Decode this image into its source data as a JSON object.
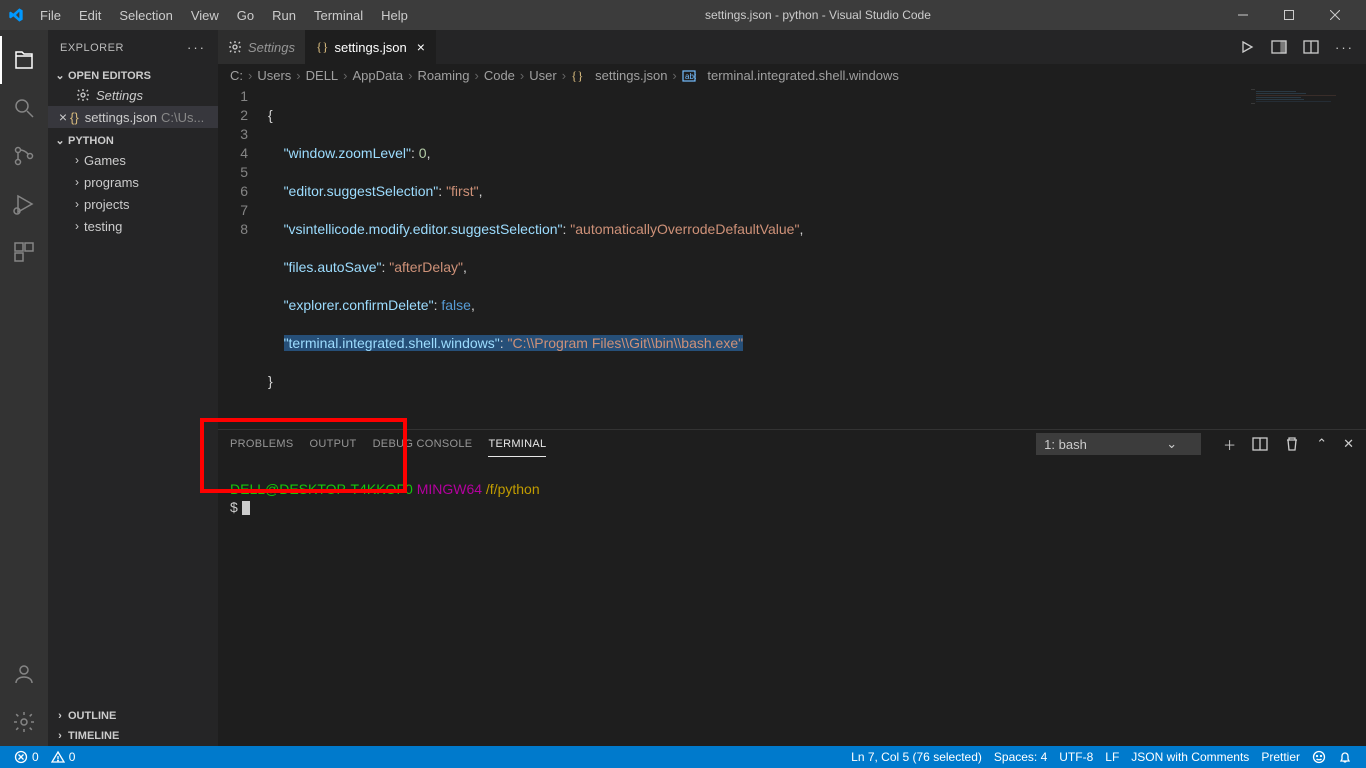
{
  "titlebar": {
    "menus": [
      "File",
      "Edit",
      "Selection",
      "View",
      "Go",
      "Run",
      "Terminal",
      "Help"
    ],
    "title": "settings.json - python - Visual Studio Code"
  },
  "sidebar": {
    "title": "EXPLORER",
    "open_editors_label": "OPEN EDITORS",
    "open_editors": [
      {
        "label": "Settings",
        "modified": false,
        "icon": "settings"
      },
      {
        "label": "settings.json",
        "suffix": "C:\\Us...",
        "modified": false,
        "icon": "braces",
        "close": true,
        "active": true
      }
    ],
    "workspace_label": "PYTHON",
    "folders": [
      "Games",
      "programs",
      "projects",
      "testing"
    ],
    "outline_label": "OUTLINE",
    "timeline_label": "TIMELINE"
  },
  "tabs": [
    {
      "label": "Settings",
      "icon": "settings",
      "active": false,
      "italic": true
    },
    {
      "label": "settings.json",
      "icon": "braces",
      "active": true,
      "close": true
    }
  ],
  "breadcrumbs": [
    "C:",
    "Users",
    "DELL",
    "AppData",
    "Roaming",
    "Code",
    "User"
  ],
  "breadcrumb_file": "settings.json",
  "breadcrumb_symbol": "terminal.integrated.shell.windows",
  "code": {
    "lines": [
      "1",
      "2",
      "3",
      "4",
      "5",
      "6",
      "7",
      "8"
    ],
    "l1": "{",
    "l2k": "\"window.zoomLevel\"",
    "l2v": "0",
    "l3k": "\"editor.suggestSelection\"",
    "l3v": "\"first\"",
    "l4k": "\"vsintellicode.modify.editor.suggestSelection\"",
    "l4v": "\"automaticallyOverrodeDefaultValue\"",
    "l5k": "\"files.autoSave\"",
    "l5v": "\"afterDelay\"",
    "l6k": "\"explorer.confirmDelete\"",
    "l6v": "false",
    "l7k": "\"terminal.integrated.shell.windows\"",
    "l7v": "\"C:\\\\Program Files\\\\Git\\\\bin\\\\bash.exe\"",
    "l8": "}"
  },
  "panel": {
    "tabs": [
      "PROBLEMS",
      "OUTPUT",
      "DEBUG CONSOLE",
      "TERMINAL"
    ],
    "active_tab": 3,
    "terminal_select": "1: bash",
    "prompt_user": "DELL@DESKTOP-T4KKOF0",
    "prompt_host": "MINGW64",
    "prompt_path": "/f/python",
    "prompt_prefix": "$"
  },
  "statusbar": {
    "errors": "0",
    "warnings": "0",
    "cursor": "Ln 7, Col 5 (76 selected)",
    "spaces": "Spaces: 4",
    "encoding": "UTF-8",
    "eol": "LF",
    "lang": "JSON with Comments",
    "formatter": "Prettier"
  }
}
